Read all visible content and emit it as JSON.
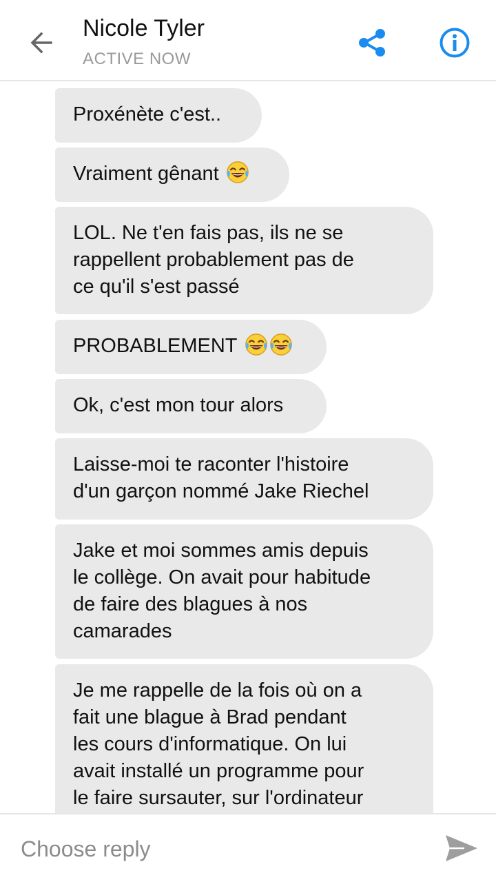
{
  "header": {
    "contact_name": "Nicole Tyler",
    "status": "ACTIVE NOW",
    "back_icon": "arrow-left-icon",
    "share_icon": "share-icon",
    "info_icon": "info-icon",
    "accent_color": "#1a8cf0"
  },
  "messages": [
    {
      "lines": [
        "Proxénète  c'est.."
      ]
    },
    {
      "lines": [
        "Vraiment gênant"
      ],
      "emoji": [
        "tears-of-joy-emoji"
      ]
    },
    {
      "lines": [
        "LOL. Ne t'en fais pas, ils ne se",
        "rappellent probablement pas de",
        "ce qu'il s'est passé"
      ]
    },
    {
      "lines": [
        "PROBABLEMENT"
      ],
      "emoji": [
        "tears-of-joy-emoji",
        "tears-of-joy-emoji"
      ]
    },
    {
      "lines": [
        "Ok, c'est mon tour alors"
      ]
    },
    {
      "lines": [
        "Laisse-moi te raconter l'histoire",
        "d'un garçon nommé Jake Riechel"
      ]
    },
    {
      "lines": [
        "Jake et moi sommes amis depuis",
        "le collège. On avait pour habitude",
        "de faire des blagues à nos",
        "camarades"
      ]
    },
    {
      "lines": [
        "Je me rappelle de la fois où on a",
        "fait une blague à Brad pendant",
        "les cours d'informatique. On lui",
        "avait installé un programme pour",
        "le faire sursauter, sur l'ordinateur"
      ]
    }
  ],
  "reply": {
    "placeholder": "Choose reply",
    "value": "",
    "send_icon": "send-icon"
  },
  "colors": {
    "bubble_background": "#e9e9e9",
    "send_icon": "#9e9e9e"
  }
}
